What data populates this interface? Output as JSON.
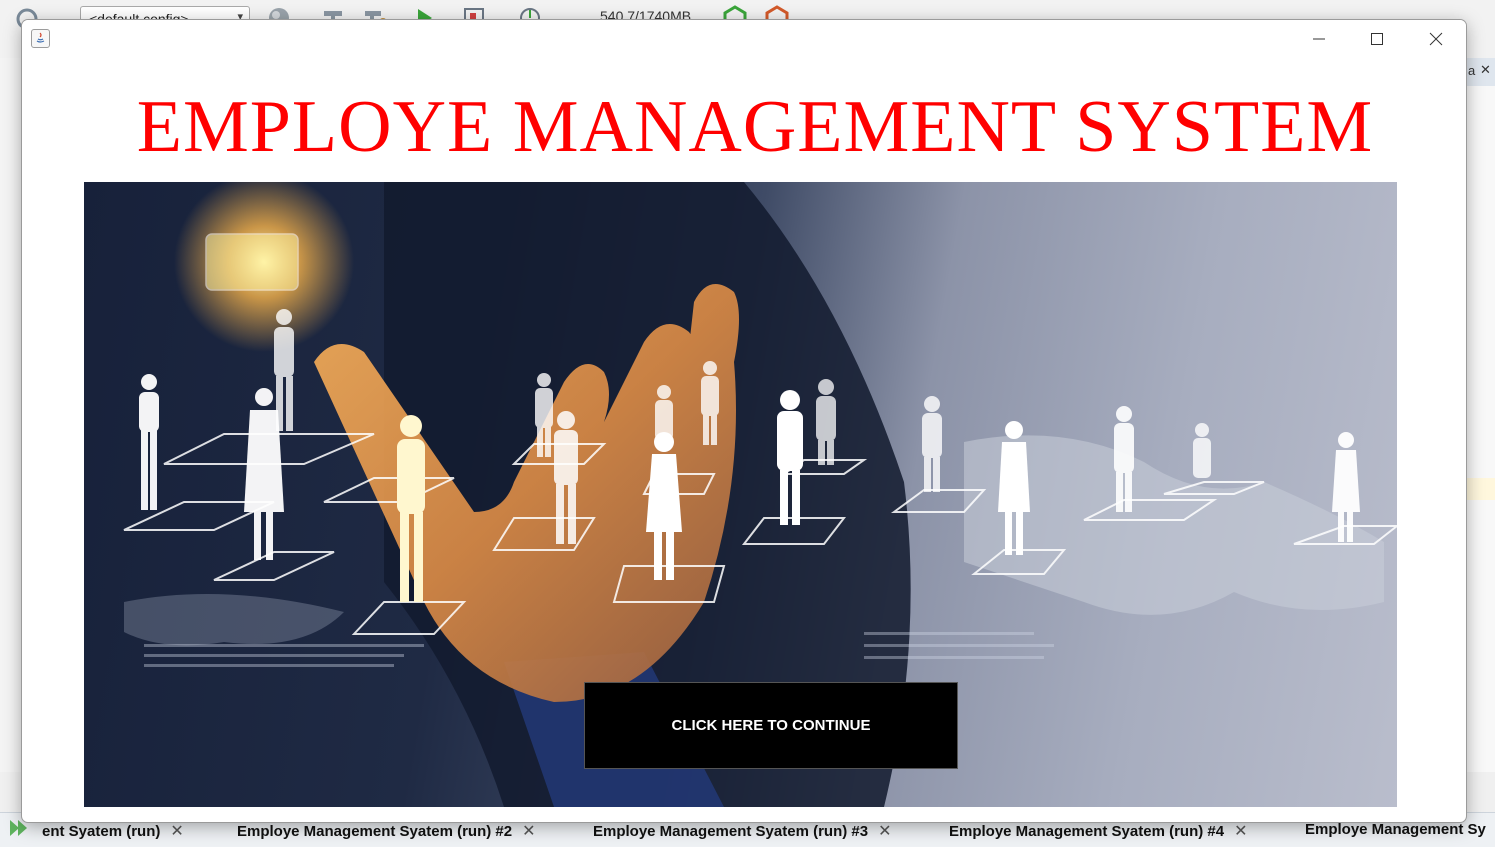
{
  "ide": {
    "config_select": "<default config>",
    "memory": "540.7/1740MB",
    "run_tabs": [
      {
        "label": "ent Syatem (run)"
      },
      {
        "label": "Employe Management Syatem (run) #2"
      },
      {
        "label": "Employe Management Syatem (run) #3"
      },
      {
        "label": "Employe Management Syatem (run) #4"
      },
      {
        "label": "Employe Management Sy"
      }
    ],
    "right_tab_tail": "a"
  },
  "window": {
    "title": "EMPLOYE MANAGEMENT SYSTEM",
    "continue_label": "CLICK HERE TO CONTINUE"
  },
  "colors": {
    "title": "#ff0000",
    "button_bg": "#000000",
    "button_text": "#ffffff"
  }
}
